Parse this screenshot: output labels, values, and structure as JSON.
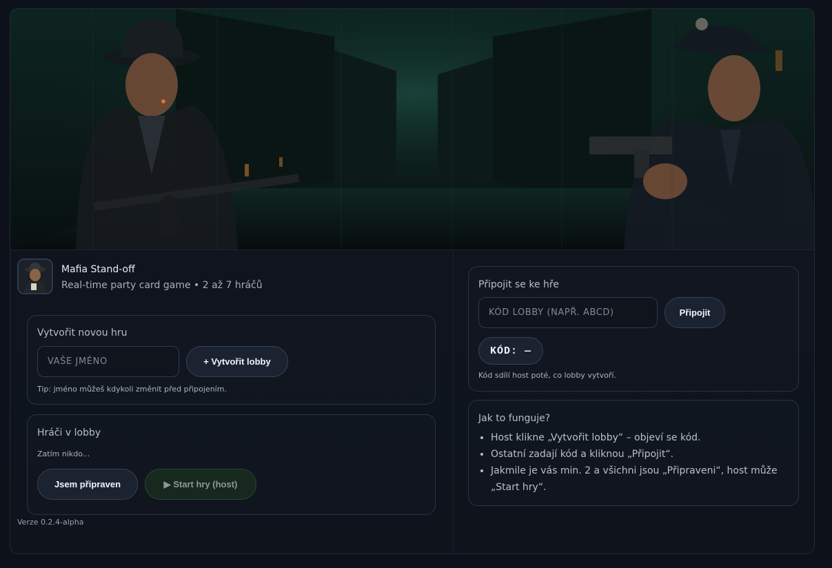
{
  "app": {
    "name": "Mafia Stand-off",
    "subtitle": "Real-time party card game • 2 až 7 hráčů"
  },
  "create": {
    "title": "Vytvořit novou hru",
    "name_placeholder": "VAŠE JMÉNO",
    "create_button": "+ Vytvořit lobby",
    "tip": "Tip: jméno můžeš kdykoli změnit před připojením."
  },
  "lobby": {
    "title": "Hráči v lobby",
    "empty_text": "Zatím nikdo...",
    "ready_button": "Jsem připraven",
    "start_button": "▶ Start hry (host)"
  },
  "join": {
    "title": "Připojit se ke hře",
    "code_placeholder": "KÓD LOBBY (NAPŘ. ABCD)",
    "join_button": "Připojit",
    "code_label": "KÓD: —",
    "note": "Kód sdílí host poté, co lobby vytvoří."
  },
  "how": {
    "title": "Jak to funguje?",
    "steps": [
      "Host klikne „Vytvořit lobby“ – objeví se kód.",
      "Ostatní zadají kód a kliknou „Připojit“.",
      "Jakmile je vás min. 2 a všichni jsou „Připraveni“, host může „Start hry“."
    ]
  },
  "footer": {
    "version": "Verze 0.2.4-alpha"
  },
  "colors": {
    "background": "#0d111a",
    "card_border": "#2c3443",
    "start_button_bg": "#17291f",
    "accent_green": "#1f3d35"
  }
}
